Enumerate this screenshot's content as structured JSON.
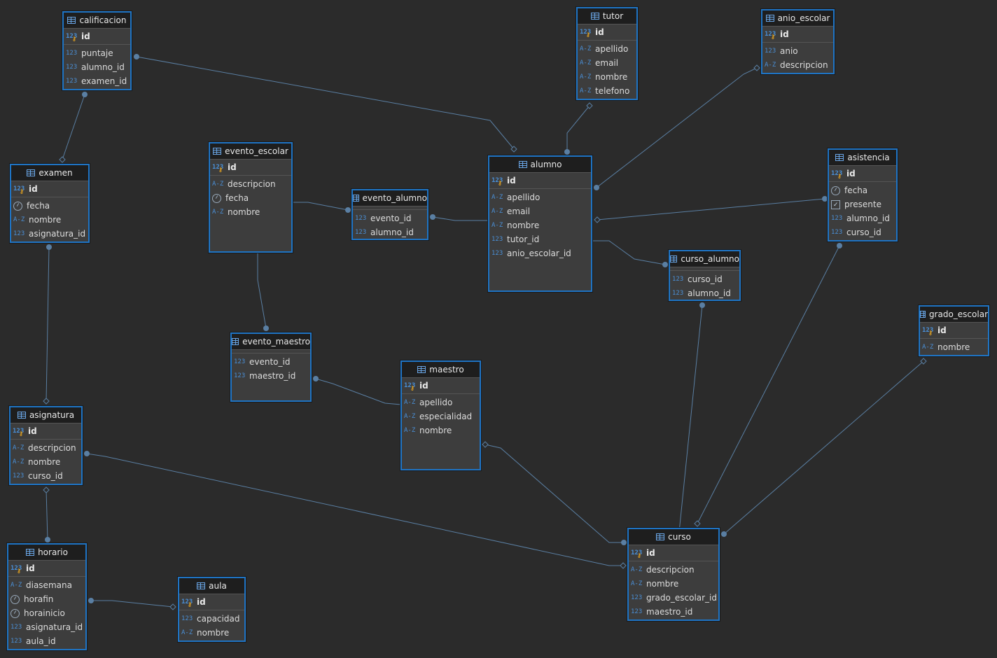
{
  "colors": {
    "background": "#2b2b2b",
    "table_border": "#1f74c4",
    "header_bg": "#1e1e1e",
    "line": "#5a7fa3"
  },
  "tables": {
    "calificacion": {
      "name": "calificacion",
      "pk": "id",
      "cols": [
        [
          "123",
          "puntaje"
        ],
        [
          "123",
          "alumno_id"
        ],
        [
          "123",
          "examen_id"
        ]
      ]
    },
    "tutor": {
      "name": "tutor",
      "pk": "id",
      "cols": [
        [
          "A-Z",
          "apellido"
        ],
        [
          "A-Z",
          "email"
        ],
        [
          "A-Z",
          "nombre"
        ],
        [
          "A-Z",
          "telefono"
        ]
      ]
    },
    "anio_escolar": {
      "name": "anio_escolar",
      "pk": "id",
      "cols": [
        [
          "123",
          "anio"
        ],
        [
          "A-Z",
          "descripcion"
        ]
      ]
    },
    "examen": {
      "name": "examen",
      "pk": "id",
      "cols": [
        [
          "clock",
          "fecha"
        ],
        [
          "A-Z",
          "nombre"
        ],
        [
          "123",
          "asignatura_id"
        ]
      ]
    },
    "evento_escolar": {
      "name": "evento_escolar",
      "pk": "id",
      "cols": [
        [
          "A-Z",
          "descripcion"
        ],
        [
          "clock",
          "fecha"
        ],
        [
          "A-Z",
          "nombre"
        ]
      ]
    },
    "evento_alumno": {
      "name": "evento_alumno",
      "cols": [
        [
          "123",
          "evento_id"
        ],
        [
          "123",
          "alumno_id"
        ]
      ]
    },
    "alumno": {
      "name": "alumno",
      "pk": "id",
      "cols": [
        [
          "A-Z",
          "apellido"
        ],
        [
          "A-Z",
          "email"
        ],
        [
          "A-Z",
          "nombre"
        ],
        [
          "123",
          "tutor_id"
        ],
        [
          "123",
          "anio_escolar_id"
        ]
      ]
    },
    "asistencia": {
      "name": "asistencia",
      "pk": "id",
      "cols": [
        [
          "clock",
          "fecha"
        ],
        [
          "check",
          "presente"
        ],
        [
          "123",
          "alumno_id"
        ],
        [
          "123",
          "curso_id"
        ]
      ]
    },
    "curso_alumno": {
      "name": "curso_alumno",
      "cols": [
        [
          "123",
          "curso_id"
        ],
        [
          "123",
          "alumno_id"
        ]
      ]
    },
    "grado_escolar": {
      "name": "grado_escolar",
      "pk": "id",
      "cols": [
        [
          "A-Z",
          "nombre"
        ]
      ]
    },
    "evento_maestro": {
      "name": "evento_maestro",
      "cols": [
        [
          "123",
          "evento_id"
        ],
        [
          "123",
          "maestro_id"
        ]
      ]
    },
    "maestro": {
      "name": "maestro",
      "pk": "id",
      "cols": [
        [
          "A-Z",
          "apellido"
        ],
        [
          "A-Z",
          "especialidad"
        ],
        [
          "A-Z",
          "nombre"
        ]
      ]
    },
    "asignatura": {
      "name": "asignatura",
      "pk": "id",
      "cols": [
        [
          "A-Z",
          "descripcion"
        ],
        [
          "A-Z",
          "nombre"
        ],
        [
          "123",
          "curso_id"
        ]
      ]
    },
    "horario": {
      "name": "horario",
      "pk": "id",
      "cols": [
        [
          "A-Z",
          "diasemana"
        ],
        [
          "clock",
          "horafin"
        ],
        [
          "clock",
          "horainicio"
        ],
        [
          "123",
          "asignatura_id"
        ],
        [
          "123",
          "aula_id"
        ]
      ]
    },
    "aula": {
      "name": "aula",
      "pk": "id",
      "cols": [
        [
          "123",
          "capacidad"
        ],
        [
          "A-Z",
          "nombre"
        ]
      ]
    },
    "curso": {
      "name": "curso",
      "pk": "id",
      "cols": [
        [
          "A-Z",
          "descripcion"
        ],
        [
          "A-Z",
          "nombre"
        ],
        [
          "123",
          "grado_escolar_id"
        ],
        [
          "123",
          "maestro_id"
        ]
      ]
    }
  }
}
